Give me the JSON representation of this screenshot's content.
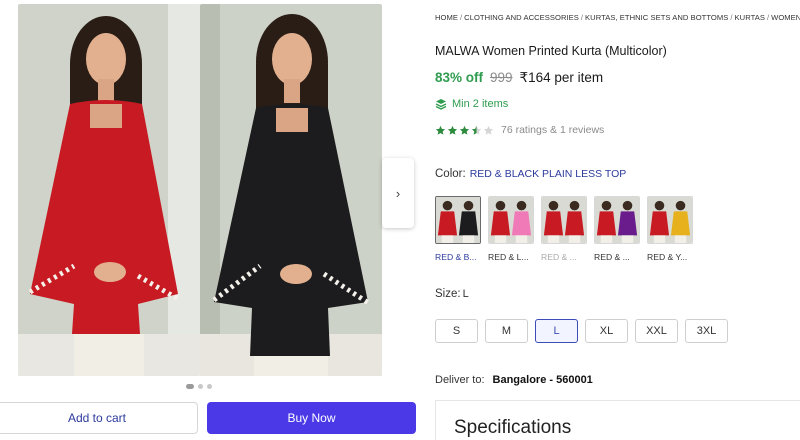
{
  "breadcrumb": [
    "HOME",
    "CLOTHING AND ACCESSORIES",
    "KURTAS, ETHNIC SETS AND BOTTOMS",
    "KURTAS",
    "WOMEN"
  ],
  "product": {
    "title": "MALWA Women Printed Kurta (Multicolor)",
    "discount": "83% off",
    "mrp": "999",
    "price": "₹164 per item",
    "min_items": "Min 2 items",
    "rating_stars": 3.5,
    "ratings_text": "76 ratings  & 1 reviews"
  },
  "gallery": {
    "next_icon": "chevron-right-icon",
    "dot_count": 3,
    "active_dot": 0,
    "colors": {
      "red": "#c81a22",
      "black": "#1c1c1e",
      "background": "#cfd3c9"
    }
  },
  "color": {
    "label": "Color:",
    "value": "RED & BLACK PLAIN LESS TOP",
    "swatches": [
      {
        "label": "RED & B...",
        "selected": true,
        "out_of_stock": false,
        "left": "#c81a22",
        "right": "#1c1c1e"
      },
      {
        "label": "RED & L...",
        "selected": false,
        "out_of_stock": false,
        "left": "#c81a22",
        "right": "#f07ab7"
      },
      {
        "label": "RED & ...",
        "selected": false,
        "out_of_stock": true,
        "left": "#c81a22",
        "right": "#c81a22"
      },
      {
        "label": "RED & ...",
        "selected": false,
        "out_of_stock": false,
        "left": "#c81a22",
        "right": "#6a1c8c"
      },
      {
        "label": "RED & Y...",
        "selected": false,
        "out_of_stock": false,
        "left": "#c81a22",
        "right": "#e6b11c"
      }
    ]
  },
  "size": {
    "label": "Size:",
    "value": "L",
    "options": [
      "S",
      "M",
      "L",
      "XL",
      "XXL",
      "3XL"
    ],
    "selected": "L"
  },
  "delivery": {
    "label": "Deliver to:",
    "value": "Bangalore - 560001"
  },
  "specifications": {
    "title": "Specifications"
  },
  "actions": {
    "add_to_cart": "Add to cart",
    "buy_now": "Buy Now"
  },
  "theme": {
    "green": "#2e9c4f",
    "accent_blue": "#2c3a9c",
    "buy_button": "#4b39e8"
  }
}
